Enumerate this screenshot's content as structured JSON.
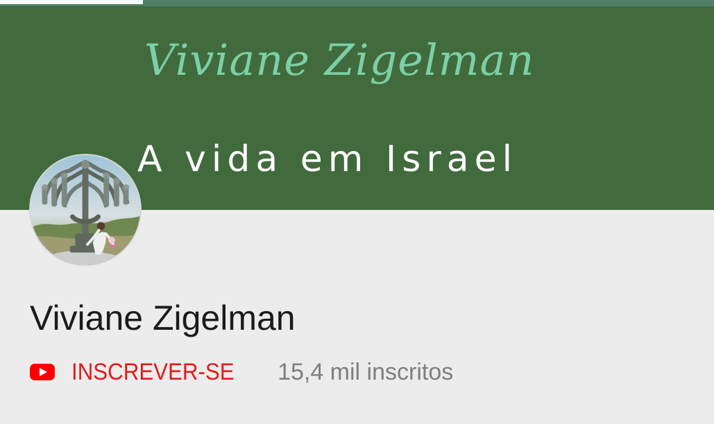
{
  "banner": {
    "title": "Viviane Zigelman",
    "subtitle": "A vida em Israel"
  },
  "channel": {
    "name": "Viviane Zigelman",
    "subscriber_count": "15,4 mil inscritos"
  },
  "actions": {
    "subscribe_label": "INSCREVER-SE"
  },
  "progress": {
    "value": 0.2
  },
  "icons": {
    "subscribe_icon": "youtube-play-icon"
  },
  "colors": {
    "banner_background": "#416b3d",
    "banner_script_text": "#7ccfa7",
    "page_background": "#ececec",
    "subscribe_red": "#e31a1a",
    "muted_text": "#7e7e7e"
  }
}
